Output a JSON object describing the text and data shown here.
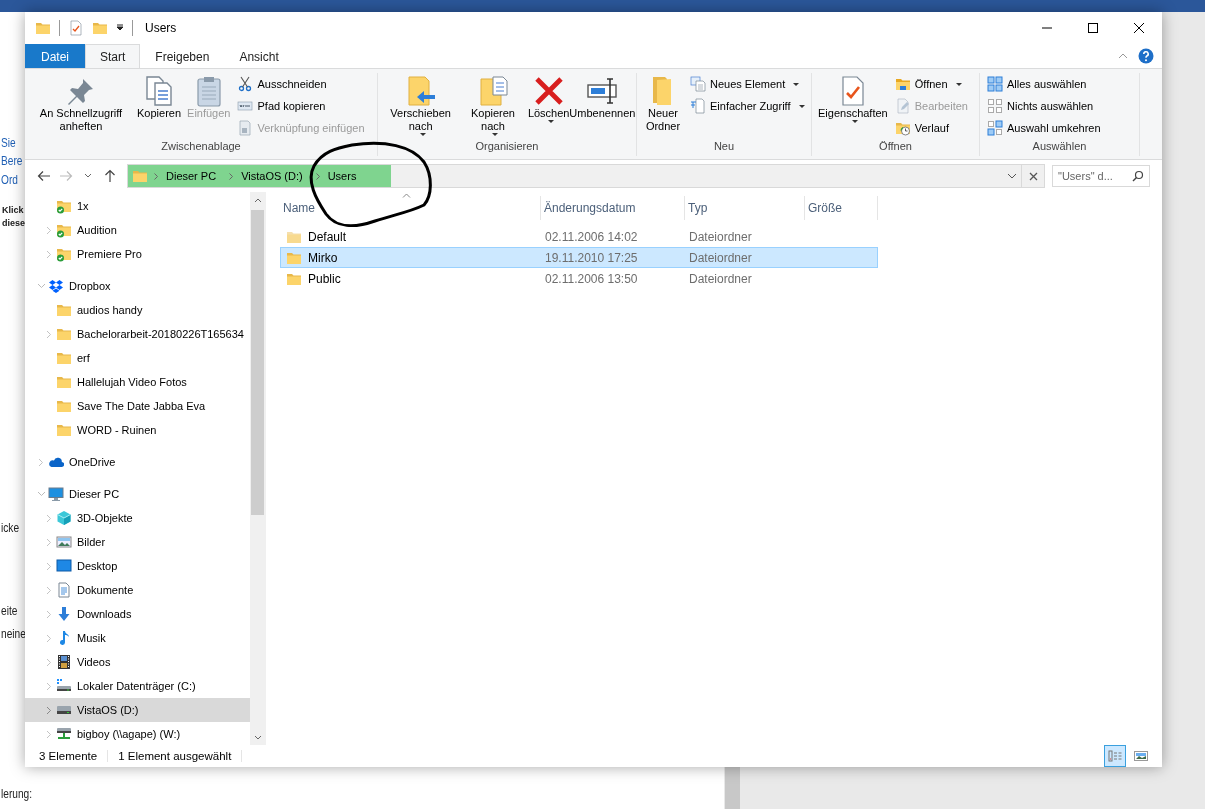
{
  "background_document": {
    "fragments": [
      {
        "text": "Sie",
        "kind": "link"
      },
      {
        "text": "Bere",
        "kind": "link"
      },
      {
        "text": "Ord",
        "kind": "link"
      },
      {
        "text": "Klick",
        "kind": "bold"
      },
      {
        "text": "diese",
        "kind": "bold"
      },
      {
        "text": "icke",
        "kind": "plain"
      },
      {
        "text": "eite",
        "kind": "plain"
      },
      {
        "text": "neine",
        "kind": "plain"
      },
      {
        "text": "lerung:",
        "kind": "plain"
      }
    ]
  },
  "window": {
    "title": "Users"
  },
  "ribbon_tabs": [
    {
      "label": "Datei",
      "kind": "file",
      "selected": false
    },
    {
      "label": "Start",
      "kind": "tab",
      "selected": true
    },
    {
      "label": "Freigeben",
      "kind": "tab",
      "selected": false
    },
    {
      "label": "Ansicht",
      "kind": "tab",
      "selected": false
    }
  ],
  "ribbon_groups": [
    {
      "label": "Zwischenablage",
      "large": [
        {
          "label": "An Schnellzugriff anheften",
          "kind": "pin",
          "disabled": false,
          "dropdown": false
        },
        {
          "label": "Kopieren",
          "kind": "copy",
          "disabled": false,
          "dropdown": false
        },
        {
          "label": "Einfügen",
          "kind": "paste",
          "disabled": true,
          "dropdown": false
        }
      ],
      "small": [
        {
          "label": "Ausschneiden",
          "kind": "cut",
          "disabled": false,
          "dropdown": false
        },
        {
          "label": "Pfad kopieren",
          "kind": "path",
          "disabled": false,
          "dropdown": false
        },
        {
          "label": "Verknüpfung einfügen",
          "kind": "shortcut",
          "disabled": true,
          "dropdown": false
        }
      ]
    },
    {
      "label": "Organisieren",
      "large": [
        {
          "label": "Verschieben nach",
          "kind": "move",
          "disabled": false,
          "dropdown": true
        },
        {
          "label": "Kopieren nach",
          "kind": "copyto",
          "disabled": false,
          "dropdown": true
        },
        {
          "label": "Löschen",
          "kind": "delete",
          "disabled": false,
          "dropdown": true
        },
        {
          "label": "Umbenennen",
          "kind": "rename",
          "disabled": false,
          "dropdown": false
        }
      ]
    },
    {
      "label": "Neu",
      "large": [
        {
          "label": "Neuer Ordner",
          "kind": "newfolder",
          "disabled": false,
          "dropdown": false
        }
      ],
      "small": [
        {
          "label": "Neues Element",
          "kind": "newitem",
          "disabled": false,
          "dropdown": true
        },
        {
          "label": "Einfacher Zugriff",
          "kind": "easy",
          "disabled": false,
          "dropdown": true
        }
      ]
    },
    {
      "label": "Öffnen",
      "large": [
        {
          "label": "Eigenschaften",
          "kind": "properties",
          "disabled": false,
          "dropdown": true
        }
      ],
      "small": [
        {
          "label": "Öffnen",
          "kind": "open",
          "disabled": false,
          "dropdown": true
        },
        {
          "label": "Bearbeiten",
          "kind": "edit",
          "disabled": true,
          "dropdown": false
        },
        {
          "label": "Verlauf",
          "kind": "history",
          "disabled": false,
          "dropdown": false
        }
      ]
    },
    {
      "label": "Auswählen",
      "small": [
        {
          "label": "Alles auswählen",
          "kind": "all",
          "disabled": false,
          "dropdown": false
        },
        {
          "label": "Nichts auswählen",
          "kind": "none",
          "disabled": false,
          "dropdown": false
        },
        {
          "label": "Auswahl umkehren",
          "kind": "invert",
          "disabled": false,
          "dropdown": false
        }
      ]
    }
  ],
  "address_bar": {
    "highlighted": true,
    "segments": [
      "Dieser PC",
      "VistaOS (D:)",
      "Users"
    ]
  },
  "search": {
    "placeholder": "\"Users\" d..."
  },
  "nav_tree": [
    {
      "children": [
        {
          "label": "1x",
          "kind": "synced",
          "selected": false
        },
        {
          "label": "Audition",
          "kind": "synced",
          "selected": false,
          "expanded": false
        },
        {
          "label": "Premiere Pro",
          "kind": "synced",
          "selected": false,
          "expanded": false
        }
      ]
    },
    {
      "label": "Dropbox",
      "kind": "dropbox",
      "selected": false,
      "expanded": true,
      "children": [
        {
          "label": "audios handy",
          "kind": "folder",
          "selected": false
        },
        {
          "label": "Bachelorarbeit-20180226T165634",
          "kind": "folder",
          "selected": false,
          "expanded": false
        },
        {
          "label": "erf",
          "kind": "folder",
          "selected": false
        },
        {
          "label": "Hallelujah Video Fotos",
          "kind": "folder",
          "selected": false
        },
        {
          "label": "Save The Date Jabba Eva",
          "kind": "folder",
          "selected": false
        },
        {
          "label": "WORD - Ruinen",
          "kind": "folder",
          "selected": false
        }
      ]
    },
    {
      "label": "OneDrive",
      "kind": "onedrive",
      "selected": false,
      "expanded": false
    },
    {
      "label": "Dieser PC",
      "kind": "pc",
      "selected": false,
      "expanded": true,
      "children": [
        {
          "label": "3D-Objekte",
          "kind": "cube",
          "selected": false,
          "expanded": false
        },
        {
          "label": "Bilder",
          "kind": "pictures",
          "selected": false,
          "expanded": false
        },
        {
          "label": "Desktop",
          "kind": "desktop",
          "selected": false,
          "expanded": false
        },
        {
          "label": "Dokumente",
          "kind": "documents",
          "selected": false,
          "expanded": false
        },
        {
          "label": "Downloads",
          "kind": "downloads",
          "selected": false,
          "expanded": false
        },
        {
          "label": "Musik",
          "kind": "music",
          "selected": false,
          "expanded": false
        },
        {
          "label": "Videos",
          "kind": "videos",
          "selected": false,
          "expanded": false
        },
        {
          "label": "Lokaler Datenträger (C:)",
          "kind": "systemdrive",
          "selected": false,
          "expanded": false
        },
        {
          "label": "VistaOS (D:)",
          "kind": "drive",
          "selected": true,
          "expanded": false
        },
        {
          "label": "bigboy (\\\\agape) (W:)",
          "kind": "netdrive",
          "selected": false,
          "expanded": false
        }
      ]
    }
  ],
  "file_list": {
    "columns": [
      "Name",
      "Änderungsdatum",
      "Typ",
      "Größe"
    ],
    "rows": [
      {
        "name": "Default",
        "date": "02.11.2006 14:02",
        "type": "Dateiordner",
        "hidden": true,
        "selected": false
      },
      {
        "name": "Mirko",
        "date": "19.11.2010 17:25",
        "type": "Dateiordner",
        "hidden": false,
        "selected": true
      },
      {
        "name": "Public",
        "date": "02.11.2006 13:50",
        "type": "Dateiordner",
        "hidden": false,
        "selected": false
      }
    ]
  },
  "status_bar": {
    "count": "3 Elemente",
    "selection": "1 Element ausgewählt",
    "views": [
      {
        "kind": "details",
        "selected": true
      },
      {
        "kind": "large",
        "selected": false
      }
    ]
  }
}
